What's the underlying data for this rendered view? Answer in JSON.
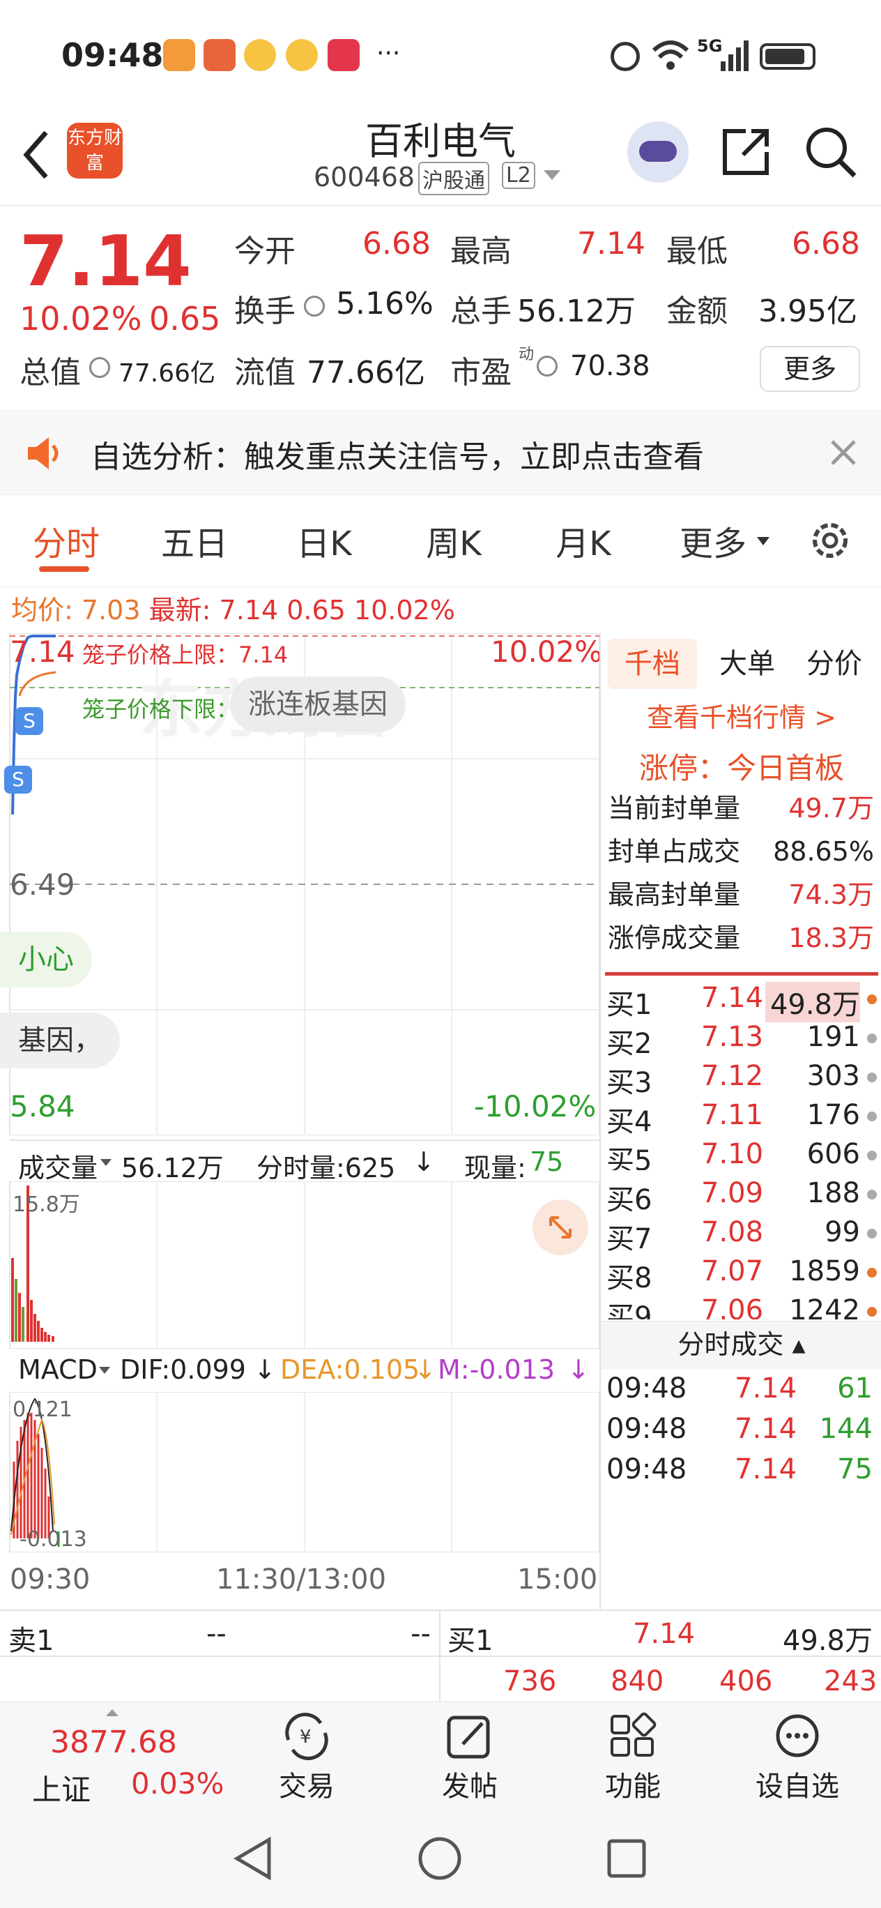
{
  "status": {
    "time": "09:48",
    "net": "5G"
  },
  "header": {
    "title": "百利电气",
    "code": "600468",
    "tag1": "沪股通",
    "tag2": "L2",
    "logo_text": "东方财富"
  },
  "quote": {
    "price": "7.14",
    "pct": "10.02%",
    "chg": "0.65",
    "open_label": "今开",
    "open": "6.68",
    "high_label": "最高",
    "high": "7.14",
    "low_label": "最低",
    "low": "6.68",
    "turnover_label": "换手",
    "turnover": "5.16%",
    "vol_label": "总手",
    "vol": "56.12万",
    "amount_label": "金额",
    "amount": "3.95亿",
    "mktcap_label": "总值",
    "mktcap": "77.66亿",
    "float_label": "流值",
    "float": "77.66亿",
    "pe_label": "市盈",
    "pe_sup": "动",
    "pe": "70.38",
    "more": "更多"
  },
  "banner": {
    "text": "自选分析：触发重点关注信号，立即点击查看"
  },
  "tabs": [
    "分时",
    "五日",
    "日K",
    "周K",
    "月K",
    "更多"
  ],
  "infobar": {
    "avg_label": "均价:",
    "avg": "7.03",
    "latest_label": "最新:",
    "latest": "7.14",
    "chg": "0.65",
    "pct": "10.02%"
  },
  "chart": {
    "top_price": "7.14",
    "top_pct": "10.02%",
    "mid_price": "6.49",
    "low_price": "5.84",
    "low_pct": "-10.02%",
    "upper_limit_label": "笼子价格上限：7.14",
    "lower_limit_label": "笼子价格下限：7.00",
    "pill1": "涨连板基因",
    "pill2": "小心",
    "pill3": "基因，",
    "watermark": "东方财富",
    "marker": "S"
  },
  "volume": {
    "label": "成交量",
    "total": "56.12万",
    "period_label": "分时量:625",
    "now_label": "现量:",
    "now": "75",
    "max": "15.8万"
  },
  "macd": {
    "label": "MACD",
    "dif": "DIF:0.099",
    "dea": "DEA:0.105",
    "m": "M:-0.013",
    "top": "0.121",
    "bottom": "-0.013"
  },
  "time_axis": [
    "09:30",
    "11:30/13:00",
    "15:00"
  ],
  "panel": {
    "tabs": [
      "千档",
      "大单",
      "分价"
    ],
    "link": "查看千档行情 >",
    "limit_title": "涨停：今日首板",
    "rows": [
      {
        "label": "当前封单量",
        "value": "49.7万"
      },
      {
        "label": "封单占成交",
        "value": "88.65%"
      },
      {
        "label": "最高封单量",
        "value": "74.3万"
      },
      {
        "label": "涨停成交量",
        "value": "18.3万"
      }
    ],
    "orderbook": [
      {
        "label": "买1",
        "price": "7.14",
        "vol": "49.8万"
      },
      {
        "label": "买2",
        "price": "7.13",
        "vol": "191"
      },
      {
        "label": "买3",
        "price": "7.12",
        "vol": "303"
      },
      {
        "label": "买4",
        "price": "7.11",
        "vol": "176"
      },
      {
        "label": "买5",
        "price": "7.10",
        "vol": "606"
      },
      {
        "label": "买6",
        "price": "7.09",
        "vol": "188"
      },
      {
        "label": "买7",
        "price": "7.08",
        "vol": "99"
      },
      {
        "label": "买8",
        "price": "7.07",
        "vol": "1859"
      },
      {
        "label": "买9",
        "price": "7.06",
        "vol": "1242"
      }
    ],
    "trades_title": "分时成交",
    "trades": [
      {
        "time": "09:48",
        "price": "7.14",
        "vol": "61"
      },
      {
        "time": "09:48",
        "price": "7.14",
        "vol": "144"
      },
      {
        "time": "09:48",
        "price": "7.14",
        "vol": "75"
      }
    ]
  },
  "level": {
    "sell_label": "卖1",
    "sell_price": "--",
    "sell_vol": "--",
    "buy_label": "买1",
    "buy_price": "7.14",
    "buy_vol": "49.8万",
    "queue": [
      "736",
      "840",
      "406",
      "243"
    ]
  },
  "bottom": {
    "index_value": "3877.68",
    "index_name": "上证",
    "index_pct": "0.03%",
    "trade": "交易",
    "post": "发帖",
    "func": "功能",
    "watch": "设自选"
  }
}
